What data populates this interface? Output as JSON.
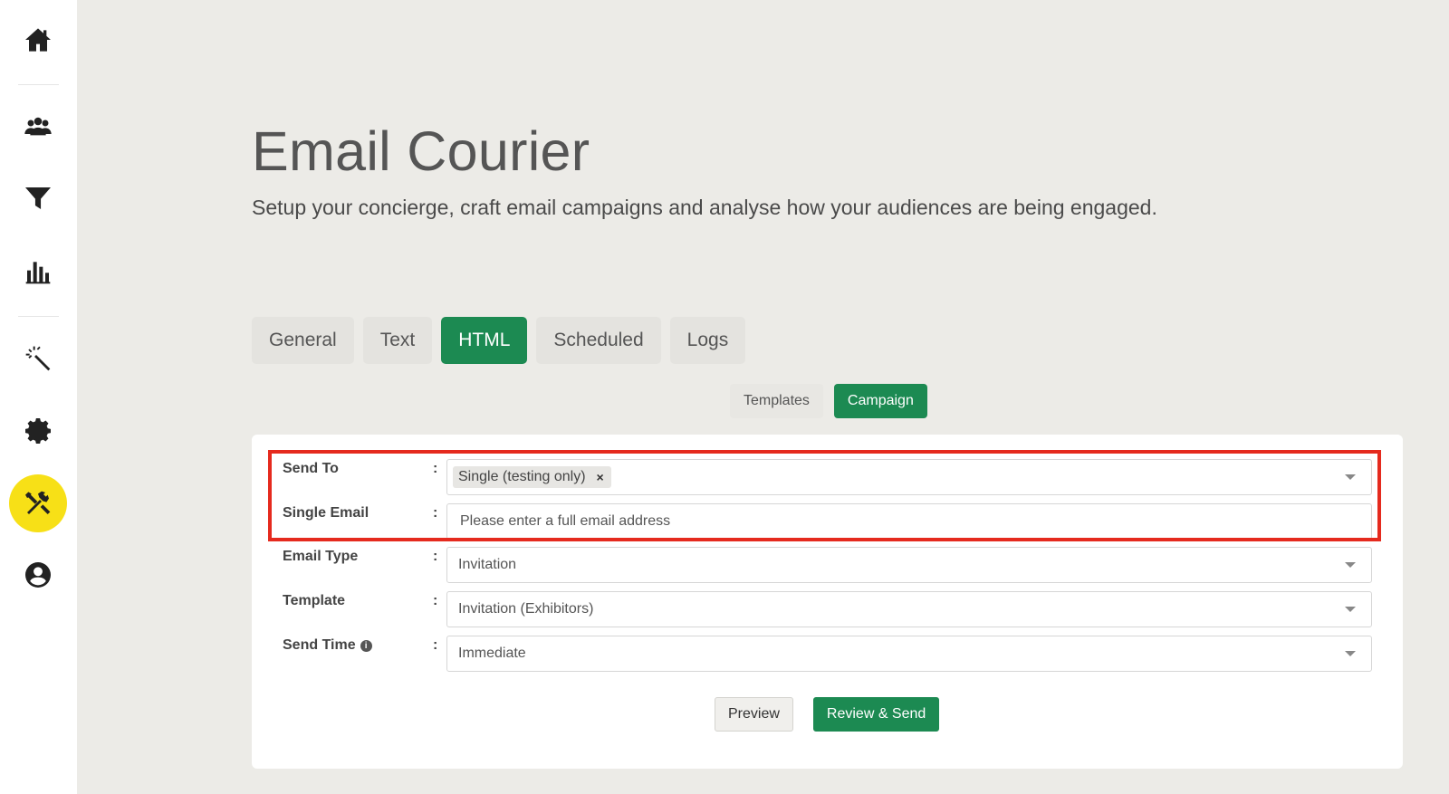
{
  "sidebar": {
    "items": [
      {
        "icon": "home-icon"
      },
      {
        "icon": "users-icon"
      },
      {
        "icon": "filter-icon"
      },
      {
        "icon": "bar-chart-icon"
      },
      {
        "icon": "magic-wand-icon"
      },
      {
        "icon": "gear-icon"
      },
      {
        "icon": "tools-icon",
        "active": true
      },
      {
        "icon": "user-circle-icon"
      }
    ],
    "active_color": "#f7e017"
  },
  "header": {
    "title": "Email Courier",
    "subtitle": "Setup your concierge, craft email campaigns and analyse how your audiences are being engaged."
  },
  "tabs": [
    {
      "label": "General"
    },
    {
      "label": "Text"
    },
    {
      "label": "HTML",
      "active": true
    },
    {
      "label": "Scheduled"
    },
    {
      "label": "Logs"
    }
  ],
  "subtabs": [
    {
      "label": "Templates"
    },
    {
      "label": "Campaign",
      "active": true
    }
  ],
  "form": {
    "colon": ":",
    "send_to": {
      "label": "Send To",
      "chip": "Single (testing only)",
      "chip_remove": "×"
    },
    "single_email": {
      "label": "Single Email",
      "placeholder": "Please enter a full email address"
    },
    "email_type": {
      "label": "Email Type",
      "value": "Invitation"
    },
    "template": {
      "label": "Template",
      "value": "Invitation (Exhibitors)"
    },
    "send_time": {
      "label": "Send Time",
      "info": "i",
      "value": "Immediate"
    }
  },
  "actions": {
    "preview": "Preview",
    "review_send": "Review & Send"
  },
  "colors": {
    "accent": "#1c8a52",
    "highlight": "#e52a1e",
    "background": "#ecebe7"
  }
}
